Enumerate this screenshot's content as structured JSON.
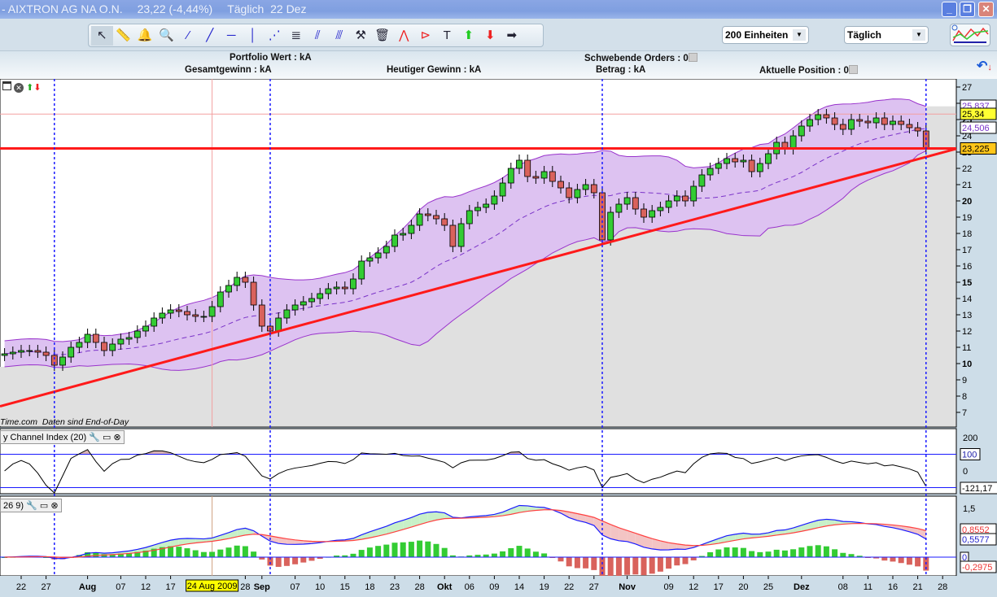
{
  "window": {
    "title_parts": [
      "- AIXTRON AG NA O.N.",
      "23,22 (-4,44%)",
      "Täglich  22 Dez"
    ],
    "buttons": [
      "minimize",
      "restore",
      "close"
    ]
  },
  "toolbar": {
    "tools": [
      "pointer-icon",
      "ruler-icon",
      "alarm-bell-icon",
      "zoom-icon",
      "line-segment-icon",
      "trendline-icon",
      "horizontal-line-icon",
      "vertical-line-icon",
      "pitchfork-icon",
      "fibonacci-icon",
      "parallel-channel-icon",
      "channel-icon",
      "tools-icon",
      "trash-icon",
      "zigzag-icon",
      "triangle-pattern-icon",
      "text-icon",
      "buy-arrow-icon",
      "sell-arrow-icon",
      "right-arrow-icon"
    ],
    "units_select": "200 Einheiten",
    "period_select": "Täglich"
  },
  "info": {
    "portfolio_wert": "Portfolio Wert : kA",
    "gesamtgewinn": "Gesamtgewinn : kA",
    "heutiger_gewinn": "Heutiger Gewinn : kA",
    "schwebende_orders": "Schwebende Orders : 0",
    "betrag": "Betrag : kA",
    "aktuelle_position": "Aktuelle Position : 0"
  },
  "panels": {
    "price_note_source": "Time.com",
    "price_note": "Daten sind End-of-Day",
    "cci_title": "y Channel Index (20)",
    "macd_title": "26 9)"
  },
  "colors": {
    "up": "#33cc33",
    "down": "#d9625c",
    "band_fill": "#d7b7ee",
    "band_line": "#9933cc",
    "trend": "#ff1a1a",
    "marker": "#1a1aff",
    "cci_fill": "#d9b3b3",
    "macd": "#1a1aff",
    "signal": "#ff4040"
  },
  "chart_data": {
    "type": "candlestick",
    "ylim": [
      6.5,
      27.5
    ],
    "yticks": [
      7,
      8,
      9,
      10,
      11,
      12,
      13,
      14,
      15,
      16,
      17,
      18,
      19,
      20,
      21,
      22,
      23,
      24,
      25,
      26,
      27
    ],
    "trading_days": {
      "2009-07": [
        20,
        21,
        22,
        23,
        24,
        27,
        28,
        29,
        30,
        31
      ],
      "2009-08": [
        3,
        4,
        5,
        6,
        7,
        10,
        11,
        12,
        13,
        14,
        17,
        18,
        19,
        20,
        21,
        24,
        25,
        26,
        27,
        28,
        31
      ],
      "2009-09": [
        1,
        2,
        3,
        4,
        7,
        8,
        9,
        10,
        11,
        14,
        15,
        16,
        17,
        18,
        21,
        22,
        23,
        24,
        25,
        28,
        29,
        30
      ],
      "2009-10": [
        1,
        2,
        5,
        6,
        7,
        8,
        9,
        12,
        13,
        14,
        15,
        16,
        19,
        20,
        21,
        22,
        23,
        26,
        27,
        28,
        29,
        30
      ],
      "2009-11": [
        2,
        3,
        4,
        5,
        6,
        9,
        10,
        11,
        12,
        13,
        16,
        17,
        18,
        19,
        20,
        23,
        24,
        25,
        26,
        27,
        30
      ],
      "2009-12": [
        1,
        2,
        3,
        4,
        7,
        8,
        9,
        10,
        11,
        14,
        15,
        16,
        17,
        18,
        21,
        22
      ]
    },
    "close": {
      "2009-07": [
        10.6,
        10.7,
        10.8,
        10.8,
        10.7,
        10.5,
        9.9,
        10.4,
        11.0,
        11.3
      ],
      "2009-08": [
        11.8,
        11.3,
        10.8,
        11.2,
        11.5,
        11.6,
        12.0,
        12.3,
        12.8,
        13.1,
        13.3,
        13.2,
        13.0,
        12.9,
        12.9,
        13.5,
        14.4,
        14.8,
        15.3,
        15.0,
        13.6
      ],
      "2009-09": [
        12.3,
        12.0,
        12.8,
        13.3,
        13.6,
        13.8,
        14.0,
        14.3,
        14.6,
        14.7,
        14.6,
        15.2,
        16.3,
        16.5,
        16.8,
        17.2,
        17.9,
        18.0,
        18.5,
        19.2,
        19.1,
        18.9
      ],
      "2009-10": [
        18.5,
        17.2,
        18.6,
        19.4,
        19.6,
        19.8,
        20.3,
        21.1,
        22.0,
        22.5,
        21.5,
        21.4,
        21.8,
        21.2,
        20.8,
        20.2,
        20.7,
        21.0,
        20.5,
        17.6,
        19.3,
        19.8
      ],
      "2009-11": [
        20.2,
        19.5,
        19.0,
        19.4,
        19.6,
        20.0,
        20.3,
        20.0,
        20.9,
        21.6,
        22.0,
        22.3,
        22.6,
        22.4,
        22.5,
        21.8,
        22.3,
        22.9,
        23.6,
        23.2,
        24.0
      ],
      "2009-12": [
        24.6,
        25.0,
        25.3,
        25.1,
        24.7,
        24.4,
        25.0,
        24.9,
        24.8,
        25.1,
        24.7,
        24.9,
        24.7,
        24.5,
        24.3,
        23.22
      ]
    },
    "xticks": [
      {
        "label": "22",
        "date": "2009-07-22"
      },
      {
        "label": "27",
        "date": "2009-07-27"
      },
      {
        "label": "Aug",
        "date": "2009-08-03",
        "month": true
      },
      {
        "label": "07",
        "date": "2009-08-07"
      },
      {
        "label": "12",
        "date": "2009-08-12"
      },
      {
        "label": "17",
        "date": "2009-08-17"
      },
      {
        "label": "28",
        "date": "2009-08-28"
      },
      {
        "label": "Sep",
        "date": "2009-09-01",
        "month": true
      },
      {
        "label": "07",
        "date": "2009-09-07"
      },
      {
        "label": "10",
        "date": "2009-09-10"
      },
      {
        "label": "15",
        "date": "2009-09-15"
      },
      {
        "label": "18",
        "date": "2009-09-18"
      },
      {
        "label": "23",
        "date": "2009-09-23"
      },
      {
        "label": "28",
        "date": "2009-09-28"
      },
      {
        "label": "Okt",
        "date": "2009-10-01",
        "month": true
      },
      {
        "label": "06",
        "date": "2009-10-06"
      },
      {
        "label": "09",
        "date": "2009-10-09"
      },
      {
        "label": "14",
        "date": "2009-10-14"
      },
      {
        "label": "19",
        "date": "2009-10-19"
      },
      {
        "label": "22",
        "date": "2009-10-22"
      },
      {
        "label": "27",
        "date": "2009-10-27"
      },
      {
        "label": "Nov",
        "date": "2009-11-02",
        "month": true
      },
      {
        "label": "09",
        "date": "2009-11-09"
      },
      {
        "label": "12",
        "date": "2009-11-12"
      },
      {
        "label": "17",
        "date": "2009-11-17"
      },
      {
        "label": "20",
        "date": "2009-11-20"
      },
      {
        "label": "25",
        "date": "2009-11-25"
      },
      {
        "label": "Dez",
        "date": "2009-12-01",
        "month": true
      },
      {
        "label": "08",
        "date": "2009-12-08"
      },
      {
        "label": "11",
        "date": "2009-12-11"
      },
      {
        "label": "16",
        "date": "2009-12-16"
      },
      {
        "label": "21",
        "date": "2009-12-21"
      },
      {
        "label": "28",
        "date": "2009-12-28"
      }
    ],
    "cursor": {
      "label": "24 Aug 2009",
      "date": "2009-08-24"
    },
    "markers": [
      "2009-07-28",
      "2009-09-02",
      "2009-10-28",
      "2009-12-22"
    ],
    "trendline": [
      [
        "2009-07-20",
        7.45
      ],
      [
        "2009-12-22",
        22.7
      ]
    ],
    "hline_red": 23.225,
    "hline_pink": 25.34,
    "price_labels": {
      "upper_band": "25,837",
      "pink_line": "25,34",
      "middle_band": "24,506",
      "last": "23,225"
    },
    "bollinger": {
      "period": 20,
      "k": 2
    },
    "cci": {
      "period": 20,
      "levels": [
        100,
        -100
      ],
      "ticks": [
        "200",
        "100",
        "0"
      ],
      "last_label": "-121,17"
    },
    "macd": {
      "fast": 12,
      "slow": 26,
      "signal": 9,
      "ticks": [
        "1,5"
      ],
      "labels": {
        "signal": "0,8552",
        "macd": "0,5577",
        "zero": "0",
        "hist": "-0,2975"
      }
    }
  }
}
